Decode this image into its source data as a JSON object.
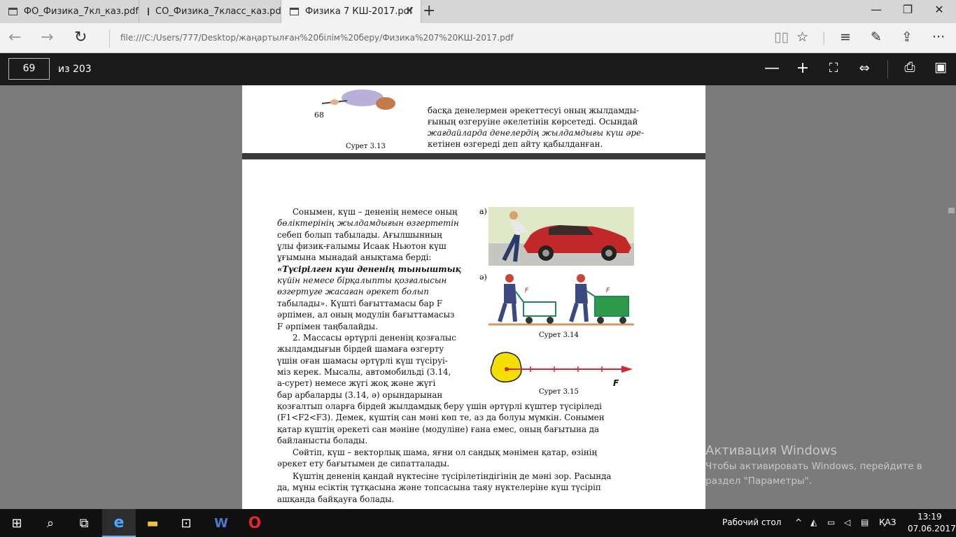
{
  "tabs": [
    {
      "label": "ФО_Физика_7кл_каз.pdf",
      "active": false
    },
    {
      "label": "СО_Физика_7класс_каз.pdf",
      "active": false
    },
    {
      "label": "Физика 7 КШ-2017.pdf",
      "active": true
    }
  ],
  "window_controls": {
    "minimize": "—",
    "maximize": "❐",
    "close": "✕"
  },
  "address": "file:///C:/Users/777/Desktop/жаңартылған%20білім%20беру/Физика%207%20КШ-2017.pdf",
  "pdf_toolbar": {
    "page_number": "69",
    "page_count": "из 203"
  },
  "page_prev": {
    "lines": [
      "басқа денелермен әрекеттесуі оның жылдамды-",
      "ғының өзгеруіне әкелетінін көрсетеді. Осындай",
      "жағдайларда денелердің жылдамдығы күш әре-",
      "кетінен өзгереді деп айту қабылданған."
    ],
    "figure_caption": "Сурет 3.13",
    "page_number": "68"
  },
  "page_current": {
    "left_column": [
      "Сонымен, күш – дененің немесе оның",
      "бөліктерінің жылдамдығын өзгертетін",
      "себеп болып табылады. Ағылшынның",
      "ұлы физик-ғалымы Исаак Ньютон күш",
      "ұғымына мынадай анықтама берді:",
      "«Түсірілген күш дененің тыныштық",
      "күйін немесе бірқалыпты қозғалысын",
      "өзгертуге жасаған әрекет болып",
      "табылады». Күшті бағыттамасы бар F",
      "әрпімен, ал оның модулін бағыттамасыз",
      "F әрпімен таңбалайды.",
      "2. Массасы әртүрлі дененің қозғалыс",
      "жылдамдығын бірдей шамаға өзгерту",
      "үшін оған шамасы әртүрлі күш түсіруі-",
      "міз керек. Мысалы, автомобильді (3.14,",
      "а-сурет) немесе жүгі жоқ және жүгі",
      "бар арбаларды (3.14, ә) орындарынан"
    ],
    "full_width": [
      "қозғалтып оларға бірдей жылдамдық беру үшін әртүрлі күштер түсіріледі",
      "(F1<F2<F3). Демек, күштің сан мәні көп те, аз да болуы мүмкін. Сонымен",
      "қатар күштің әрекеті сан мәніне (модуліне) ғана емес, оның бағытына  да",
      "байланысты болады.",
      "Сөйтіп, күш – векторлық шама, яғни ол сандық мәнімен қатар, өзінің",
      "әрекет ету бағытымен де сипатталады.",
      "Күштің дененің қандай нүктесіне түсірілетіндігінің де мәні зор. Расында",
      "да, мұны есіктің тұтқасына және топсасына таяу нүктелеріне күш түсіріп",
      "ашқанда байқауға болады."
    ],
    "figure_a_label": "а)",
    "figure_b_label": "ә)",
    "figure_314_caption": "Сурет 3.14",
    "figure_315_caption": "Сурет 3.15",
    "force_label": "F",
    "cart_force_label": "F"
  },
  "watermark": {
    "title": "Активация Windows",
    "line1": "Чтобы активировать Windows, перейдите в",
    "line2": "раздел \"Параметры\"."
  },
  "taskbar": {
    "desktop_label": "Рабочий стол",
    "language": "ҚАЗ",
    "time": "13:19",
    "date": "07.06.2017"
  },
  "colors": {
    "accent": "#0078d7",
    "car": "#c0282a",
    "blob": "#f3e000",
    "arrow": "#d6262f"
  }
}
